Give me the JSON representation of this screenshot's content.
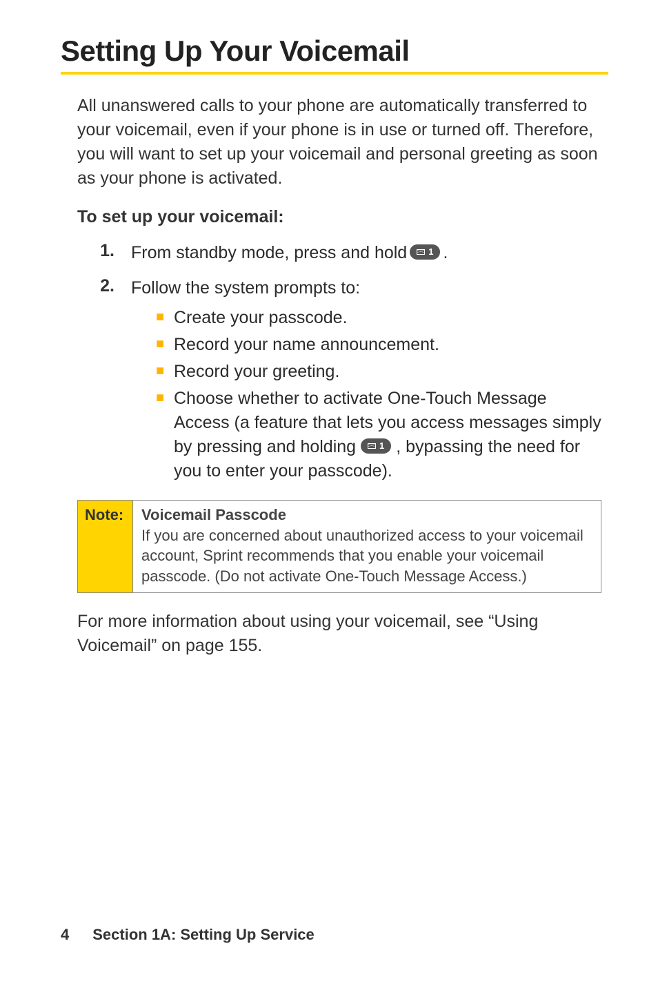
{
  "title": "Setting Up Your Voicemail",
  "intro": "All unanswered calls to your phone are automatically transferred to your voicemail, even if your phone is in use or turned off. Therefore, you will want to set up your voicemail and personal greeting as soon as your phone is activated.",
  "subhead": "To set up your voicemail:",
  "steps": {
    "one_num": "1.",
    "one_a": "From standby mode, press and hold ",
    "one_b": ".",
    "two_num": "2.",
    "two": "Follow the system prompts to:"
  },
  "bullets": {
    "b1": "Create your passcode.",
    "b2": "Record your name announcement.",
    "b3": "Record your greeting.",
    "b4_a": "Choose whether to activate One-Touch Message Access (a feature that lets you access messages simply by pressing and holding ",
    "b4_b": ", bypassing the need for you to enter your passcode)."
  },
  "key": {
    "digit": "1"
  },
  "note": {
    "label": "Note:",
    "title": "Voicemail Passcode",
    "body": "If you are concerned about unauthorized access to your voicemail account, Sprint recommends that you enable your voicemail passcode. (Do not activate One-Touch Message Access.)"
  },
  "outro": "For more information about using your voicemail, see “Using Voicemail” on page 155.",
  "footer": {
    "page": "4",
    "section": "Section 1A: Setting Up Service"
  }
}
